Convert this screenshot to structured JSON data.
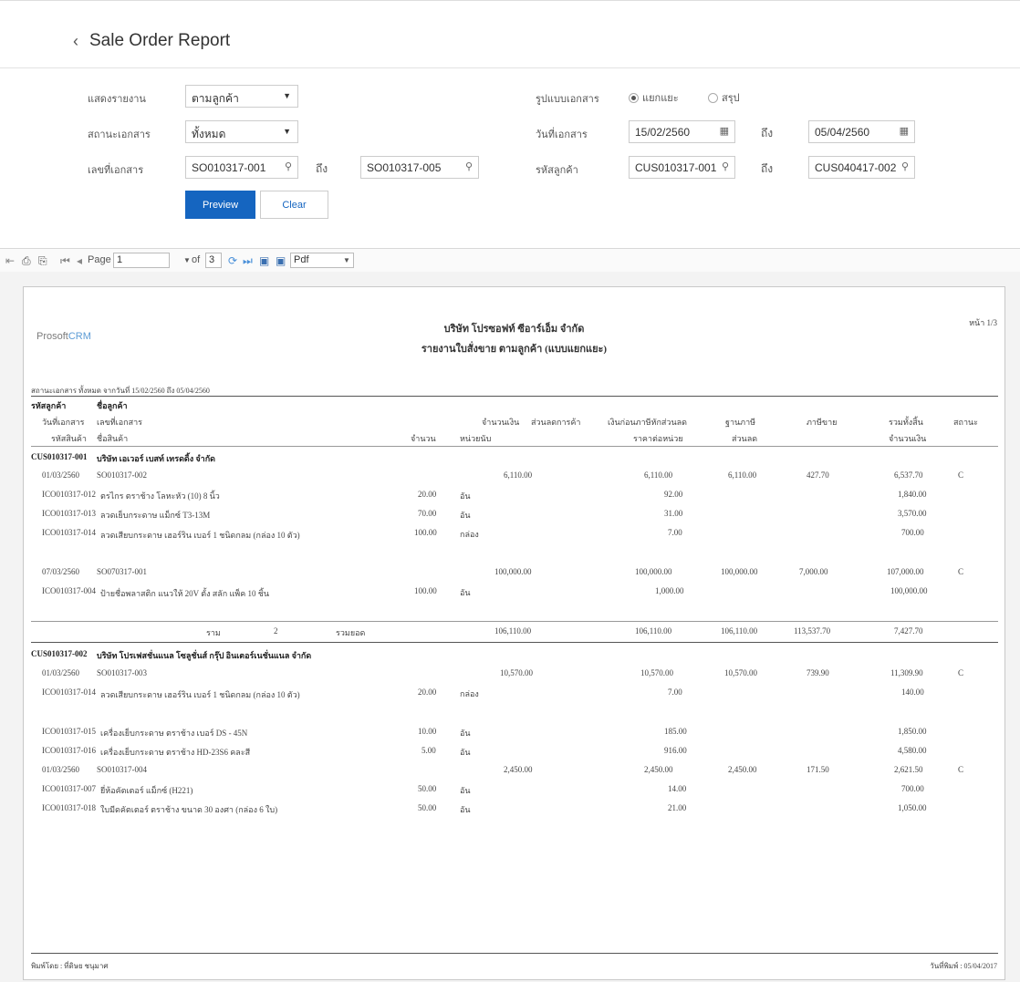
{
  "header": {
    "back_icon": "‹",
    "title": "Sale Order Report"
  },
  "filter": {
    "report_by_label": "แสดงรายงาน",
    "report_by_value": "ตามลูกค้า",
    "status_label": "สถานะเอกสาร",
    "status_value": "ทั้งหมด",
    "docno_label": "เลขที่เอกสาร",
    "docno_from": "SO010317-001",
    "docno_to": "SO010317-005",
    "format_label": "รูปแบบเอกสาร",
    "format_detail": "แยกแยะ",
    "format_summary": "สรุป",
    "date_label": "วันที่เอกสาร",
    "date_from": "15/02/2560",
    "date_to": "05/04/2560",
    "customer_label": "รหัสลูกค้า",
    "customer_from": "CUS010317-001",
    "customer_to": "CUS040417-002",
    "to_label": "ถึง",
    "preview": "Preview",
    "clear": "Clear"
  },
  "toolbar": {
    "page_label": "Page",
    "page_value": "1",
    "of_label": "of",
    "total_pages": "3",
    "format": "Pdf"
  },
  "report": {
    "page_no": "หน้า 1/3",
    "logo_a": "Prosoft",
    "logo_b": "CRM",
    "company": "บริษัท โปรซอฟท์ ซีอาร์เอ็ม จำกัด",
    "subtitle": "รายงานใบสั่งขาย ตามลูกค้า (แบบแยกแยะ)",
    "criteria": "สถานะเอกสาร ทั้งหมด จากวันที่ 15/02/2560 ถึง 05/04/2560",
    "headers": {
      "cust_code": "รหัสลูกค้า",
      "cust_name": "ชื่อลูกค้า",
      "doc_date": "วันที่เอกสาร",
      "doc_no": "เลขที่เอกสาร",
      "amount": "จำนวนเงิน",
      "discount": "ส่วนลดการค้า",
      "before_vat": "เงินก่อนภาษีหักส่วนลด",
      "vat_base": "ฐานภาษี",
      "vat": "ภาษีขาย",
      "total": "รวมทั้งสิ้น",
      "status": "สถานะ",
      "prod_code": "รหัสสินค้า",
      "prod_name": "ชื่อสินค้า",
      "qty": "จำนวน",
      "unit": "หน่วยนับ",
      "unit_price": "ราคาต่อหน่วย",
      "discount2": "ส่วนลด",
      "line_amount": "จำนวนเงิน"
    },
    "groups": [
      {
        "code": "CUS010317-001",
        "name": "บริษัท เอเวอร์ เบสท์ เทรดดิ้ง จำกัด",
        "docs": [
          {
            "date": "01/03/2560",
            "no": "SO010317-002",
            "amount": "6,110.00",
            "before_vat": "6,110.00",
            "vat_base": "6,110.00",
            "vat": "427.70",
            "total": "6,537.70",
            "status": "C",
            "lines": [
              {
                "code": "ICO010317-012",
                "name": "ตรไกร ตราช้าง โลหะหัว (10) 8 นิ้ว",
                "qty": "20.00",
                "unit": "อัน",
                "price": "92.00",
                "amount": "1,840.00"
              },
              {
                "code": "ICO010317-013",
                "name": "ลวดเย็บกระดาษ แม็กซ์ T3-13M",
                "qty": "70.00",
                "unit": "อัน",
                "price": "31.00",
                "amount": "3,570.00"
              },
              {
                "code": "ICO010317-014",
                "name": "ลวดเสียบกระดาษ เฮอร์ริน เบอร์ 1 ชนิดกลม (กล่อง 10 ตัว)",
                "qty": "100.00",
                "unit": "กล่อง",
                "price": "7.00",
                "amount": "700.00"
              }
            ]
          },
          {
            "date": "07/03/2560",
            "no": "SO070317-001",
            "amount": "100,000.00",
            "before_vat": "100,000.00",
            "vat_base": "100,000.00",
            "vat": "7,000.00",
            "total": "107,000.00",
            "status": "C",
            "lines": [
              {
                "code": "ICO010317-004",
                "name": "ป้ายชื่อพลาสติก แนวให้ 20V ตั้ง สลัก แพ็ค 10 ชิ้น",
                "qty": "100.00",
                "unit": "อัน",
                "price": "1,000.00",
                "amount": "100,000.00"
              }
            ]
          }
        ],
        "subtotal": {
          "c1": "ราม",
          "c2": "2",
          "c3": "รวมยอด",
          "amount": "106,110.00",
          "before_vat": "106,110.00",
          "vat_base": "106,110.00",
          "vat": "113,537.70",
          "total": "7,427.70"
        }
      },
      {
        "code": "CUS010317-002",
        "name": "บริษัท โปรเฟสชั่นแนล โซลูชั่นส์ กรุ๊ป อินเตอร์เนชั่นแนล จำกัด",
        "docs": [
          {
            "date": "01/03/2560",
            "no": "SO010317-003",
            "amount": "10,570.00",
            "before_vat": "10,570.00",
            "vat_base": "10,570.00",
            "vat": "739.90",
            "total": "11,309.90",
            "status": "C",
            "lines": [
              {
                "code": "ICO010317-014",
                "name": "ลวดเสียบกระดาษ เฮอร์ริน เบอร์ 1 ชนิดกลม (กล่อง 10 ตัว)",
                "qty": "20.00",
                "unit": "กล่อง",
                "price": "7.00",
                "amount": "140.00"
              },
              {
                "code": "ICO010317-015",
                "name": "เครื่องเย็บกระดาษ ตราช้าง เบอร์ DS - 45N",
                "qty": "10.00",
                "unit": "อัน",
                "price": "185.00",
                "amount": "1,850.00"
              },
              {
                "code": "ICO010317-016",
                "name": "เครื่องเย็บกระดาษ ตราช้าง HD-23S6 คละสี",
                "qty": "5.00",
                "unit": "อัน",
                "price": "916.00",
                "amount": "4,580.00"
              }
            ]
          },
          {
            "date": "01/03/2560",
            "no": "SO010317-004",
            "amount": "2,450.00",
            "before_vat": "2,450.00",
            "vat_base": "2,450.00",
            "vat": "171.50",
            "total": "2,621.50",
            "status": "C",
            "lines": [
              {
                "code": "ICO010317-007",
                "name": "ยี่ห้อคัตเตอร์ แม็กซ์ (H221)",
                "qty": "50.00",
                "unit": "อัน",
                "price": "14.00",
                "amount": "700.00"
              },
              {
                "code": "ICO010317-018",
                "name": "ใบมีดคัตเตอร์ ตราช้าง ขนาด 30 องศา (กล่อง 6 ใบ)",
                "qty": "50.00",
                "unit": "อัน",
                "price": "21.00",
                "amount": "1,050.00"
              }
            ]
          }
        ]
      }
    ],
    "footer_left": "พิมพ์โดย : ที่ดิษย ชนุมาศ",
    "footer_right": "วันที่พิมพ์ : 05/04/2017"
  }
}
